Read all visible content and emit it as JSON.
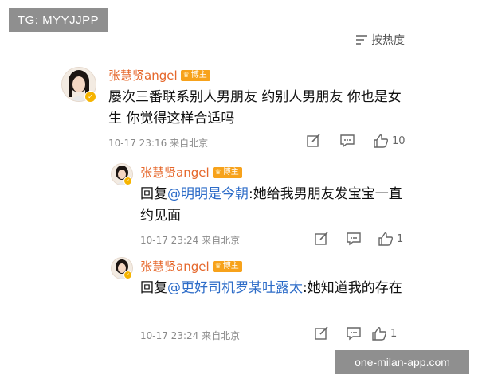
{
  "watermark_top": "TG: MYYJJPP",
  "watermark_bottom": "one-milan-app.com",
  "sort": {
    "label": "按热度",
    "icon": "sort-icon"
  },
  "main_comment": {
    "username": "张慧贤angel",
    "badge": "博主",
    "text": "屡次三番联系别人男朋友 约别人男朋友 你也是女生 你觉得这样合适吗",
    "time": "10-17 23:16",
    "source": "来自北京",
    "likes": "10"
  },
  "replies": [
    {
      "username": "张慧贤angel",
      "badge": "博主",
      "prefix": "回复",
      "mention": "@明明是今朝",
      "text": ":她给我男朋友发宝宝一直约见面",
      "time": "10-17 23:24",
      "source": "来自北京",
      "likes": "1"
    },
    {
      "username": "张慧贤angel",
      "badge": "博主",
      "prefix": "回复",
      "mention": "@更好司机罗某吐露太",
      "text": ":她知道我的存在",
      "time": "10-17 23:24",
      "source": "来自北京",
      "likes": "1"
    }
  ],
  "icons": {
    "edit": "edit-icon",
    "comment": "comment-icon",
    "like": "thumbs-up-icon",
    "verified": "verified-icon"
  },
  "colors": {
    "username": "#e5672b",
    "mention": "#2d6cc8",
    "badge": "#f7a21b",
    "meta": "#8a8a8a"
  }
}
